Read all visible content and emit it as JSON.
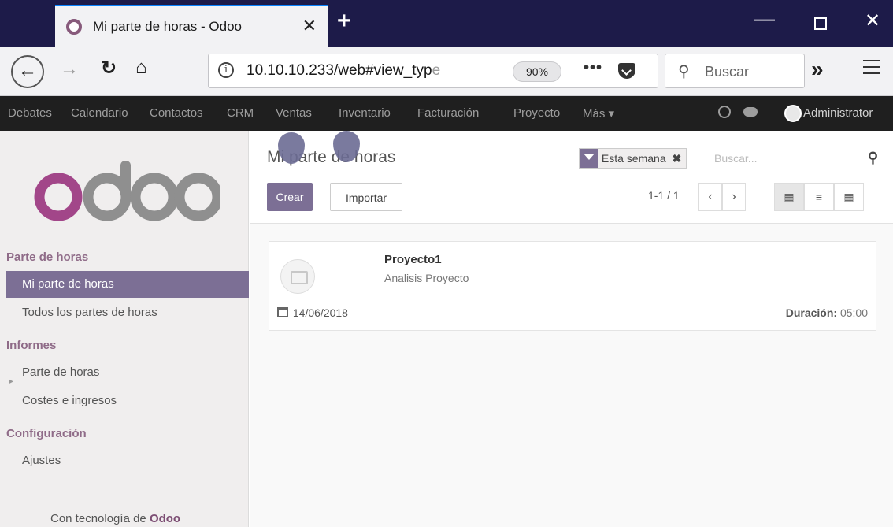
{
  "browser": {
    "tab_title": "Mi parte de horas - Odoo",
    "tab_close": "✕",
    "new_tab": "+",
    "url_main": "10.10.10.233/web#view_typ",
    "url_faded": "e",
    "zoom": "90%",
    "url_more": "•••",
    "search_placeholder": "Buscar",
    "overflow": "»"
  },
  "topnav": {
    "items": [
      "Debates",
      "Calendario",
      "Contactos",
      "CRM",
      "Ventas",
      "Inventario",
      "Facturación",
      "Proyecto",
      "Más ▾"
    ],
    "user": "Administrator"
  },
  "sidebar": {
    "sections": [
      {
        "title": "Parte de horas",
        "items": [
          "Mi parte de horas",
          "Todos los partes de horas"
        ]
      },
      {
        "title": "Informes",
        "items": [
          "Parte de horas",
          "Costes e ingresos"
        ]
      },
      {
        "title": "Configuración",
        "items": [
          "Ajustes"
        ]
      }
    ],
    "active_item": "Mi parte de horas",
    "powered_prefix": "Con tecnología de",
    "powered_brand": "Odoo"
  },
  "control_panel": {
    "title": "Mi parte de horas",
    "create_label": "Crear",
    "import_label": "Importar",
    "facet_label": "Esta semana",
    "facet_close": "✖",
    "search_placeholder": "Buscar...",
    "pager_text": "1-1 / 1",
    "pager_prev": "‹",
    "pager_next": "›"
  },
  "records": [
    {
      "title": "Proyecto1",
      "subtitle": "Analisis Proyecto",
      "date": "14/06/2018",
      "duration_label": "Duración:",
      "duration_value": "05:00"
    }
  ],
  "colors": {
    "odoo_purple": "#7c6f95",
    "odoo_brand": "#875a7b",
    "topnav_bg": "#1f1f1f",
    "tabstrip_bg": "#1d1b49"
  },
  "icons": [
    "odoo-favicon-icon",
    "back-arrow-icon",
    "forward-arrow-icon",
    "reload-icon",
    "home-icon",
    "info-icon",
    "pocket-icon",
    "search-icon",
    "hamburger-icon",
    "clock-icon",
    "chat-icon",
    "filter-icon",
    "kanban-icon",
    "list-icon",
    "calendar-icon"
  ]
}
